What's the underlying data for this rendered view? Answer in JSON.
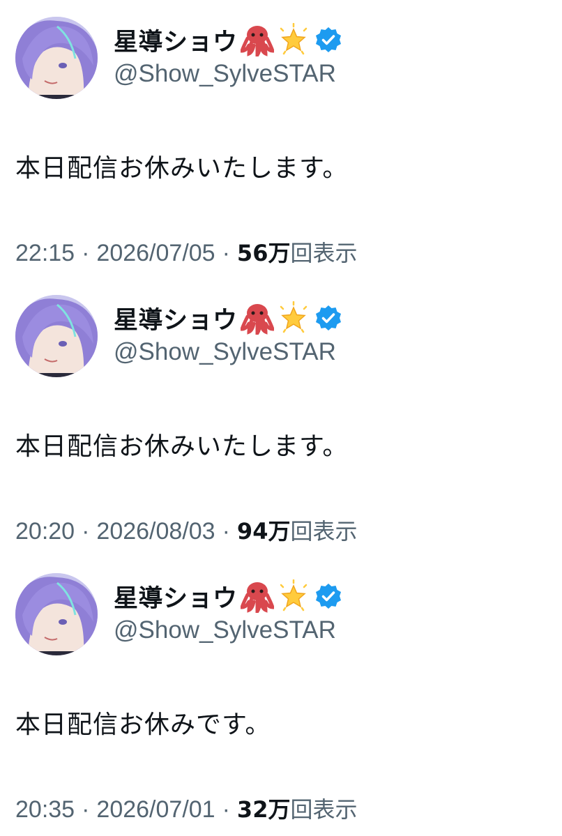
{
  "tweets": [
    {
      "display_name": "星導ショウ",
      "handle": "@Show_SylveSTAR",
      "text": "本日配信お休みいたします。",
      "time": "22:15",
      "date": "2026/07/05",
      "separator": "·",
      "views_count": "56万",
      "views_label": "回表示"
    },
    {
      "display_name": "星導ショウ",
      "handle": "@Show_SylveSTAR",
      "text": "本日配信お休みいたします。",
      "time": "20:20",
      "date": "2026/08/03",
      "separator": "·",
      "views_count": "94万",
      "views_label": "回表示"
    },
    {
      "display_name": "星導ショウ",
      "handle": "@Show_SylveSTAR",
      "text": "本日配信お休みです。",
      "time": "20:35",
      "date": "2026/07/01",
      "separator": "·",
      "views_count": "32万",
      "views_label": "回表示"
    }
  ],
  "icons": {
    "avatar": "anime-character-avatar",
    "emoji_1": "octopus-emoji-icon",
    "emoji_2": "glowing-star-emoji-icon",
    "verified": "verified-badge-icon"
  },
  "colors": {
    "text_primary": "#0f1419",
    "text_secondary": "#536471",
    "verified_blue": "#1d9bf0"
  }
}
